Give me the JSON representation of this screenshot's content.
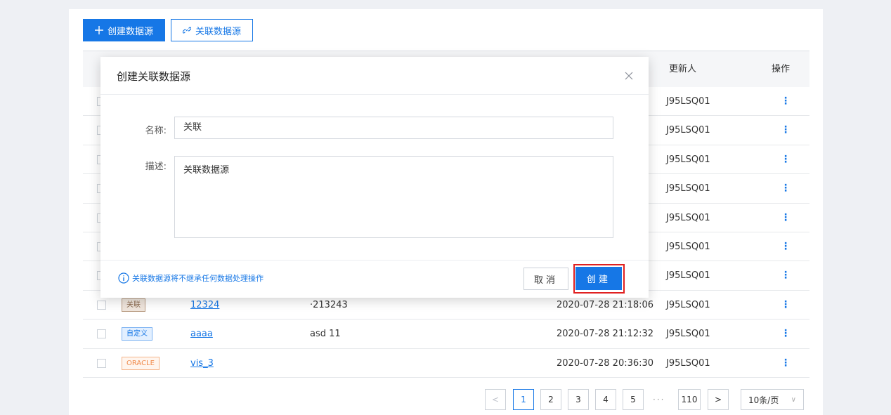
{
  "toolbar": {
    "create_label": "创建数据源",
    "link_label": "关联数据源"
  },
  "table": {
    "headers": {
      "updater": "更新人",
      "actions": "操作"
    },
    "hidden_rows": [
      {
        "updater": "J95LSQ01",
        "actions": "⋮"
      },
      {
        "updater": "J95LSQ01",
        "actions": "⋮"
      },
      {
        "updater": "J95LSQ01",
        "actions": "⋮"
      },
      {
        "updater": "J95LSQ01",
        "actions": "⋮"
      },
      {
        "updater": "J95LSQ01",
        "actions": "⋮"
      },
      {
        "updater": "J95LSQ01",
        "actions": "⋮"
      },
      {
        "updater": "J95LSQ01",
        "actions": "⋮"
      }
    ],
    "rows": [
      {
        "tag": "关联",
        "name": "12324",
        "desc": "·213243",
        "time": "2020-07-28 21:18:06",
        "updater": "J95LSQ01",
        "actions": "⋮"
      },
      {
        "tag": "自定义",
        "name": "aaaa",
        "desc": "asd 11",
        "time": "2020-07-28 21:12:32",
        "updater": "J95LSQ01",
        "actions": "⋮"
      },
      {
        "tag": "ORACLE",
        "name": "vis_3",
        "desc": "",
        "time": "2020-07-28 20:36:30",
        "updater": "J95LSQ01",
        "actions": "⋮"
      }
    ]
  },
  "pagination": {
    "prev": "<",
    "pages": [
      "1",
      "2",
      "3",
      "4",
      "5"
    ],
    "ellipsis": "···",
    "last": "110",
    "next": ">",
    "page_size": "10条/页",
    "page_size_arrow": "∨"
  },
  "modal": {
    "title": "创建关联数据源",
    "name_label": "名称:",
    "name_value": "关联",
    "desc_label": "描述:",
    "desc_value": "关联数据源",
    "tip": "关联数据源将不继承任何数据处理操作",
    "cancel_label": "取消",
    "create_label": "创建"
  },
  "colors": {
    "accent": "#1677e6",
    "highlight": "#e02020"
  }
}
